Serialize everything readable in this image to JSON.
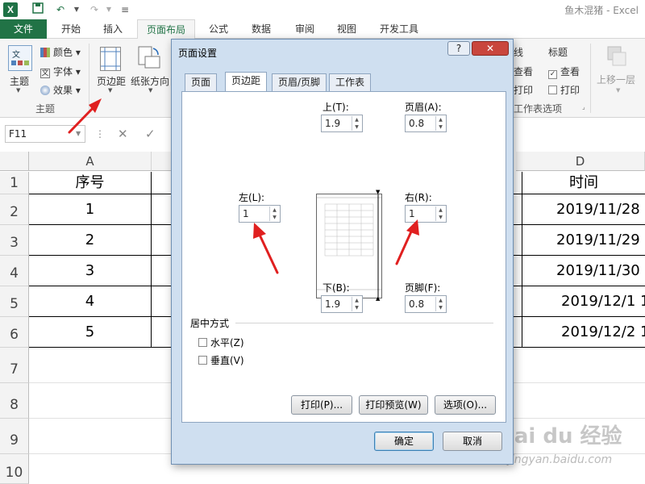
{
  "window": {
    "title": "鱼木混猪 - Excel"
  },
  "quick_access": {
    "logo": "X"
  },
  "tabs": [
    "文件",
    "开始",
    "插入",
    "页面布局",
    "公式",
    "数据",
    "审阅",
    "视图",
    "开发工具"
  ],
  "ribbon": {
    "theme_button": "主题",
    "colors": "颜色",
    "fonts": "字体",
    "effects": "效果",
    "theme_group": "主题",
    "margins": "页边距",
    "orientation": "纸张方向",
    "gridlines_title": "线",
    "gridlines_view": "查看",
    "gridlines_print": "打印",
    "headings_title": "标题",
    "headings_view": "查看",
    "headings_print": "打印",
    "sheet_options_group": "工作表选项",
    "bring_forward": "上移一层"
  },
  "formula_bar": {
    "name_box": "F11"
  },
  "sheet": {
    "columns": [
      "A",
      "D"
    ],
    "rows": [
      "1",
      "2",
      "3",
      "4",
      "5",
      "6",
      "7",
      "8",
      "9",
      "10"
    ],
    "col_a": [
      "序号",
      "1",
      "2",
      "3",
      "4",
      "5"
    ],
    "col_d": [
      "时间",
      "2019/11/28",
      "2019/11/29",
      "2019/11/30",
      "2019/12/1 1",
      "2019/12/2 1"
    ]
  },
  "dialog": {
    "title": "页面设置",
    "help": "?",
    "close": "✕",
    "tabs": [
      "页面",
      "页边距",
      "页眉/页脚",
      "工作表"
    ],
    "top_label": "上(T):",
    "top_value": "1.9",
    "header_label": "页眉(A):",
    "header_value": "0.8",
    "left_label": "左(L):",
    "left_value": "1",
    "right_label": "右(R):",
    "right_value": "1",
    "bottom_label": "下(B):",
    "bottom_value": "1.9",
    "footer_label": "页脚(F):",
    "footer_value": "0.8",
    "center_section": "居中方式",
    "horizontal": "水平(Z)",
    "vertical": "垂直(V)",
    "print_btn": "打印(P)...",
    "preview_btn": "打印预览(W)",
    "options_btn": "选项(O)...",
    "ok_btn": "确定",
    "cancel_btn": "取消"
  },
  "watermark": {
    "brand": "Bai du 经验",
    "url": "jingyan.baidu.com"
  },
  "colors": {
    "excel_green": "#217346",
    "arrow_red": "#e02020"
  }
}
